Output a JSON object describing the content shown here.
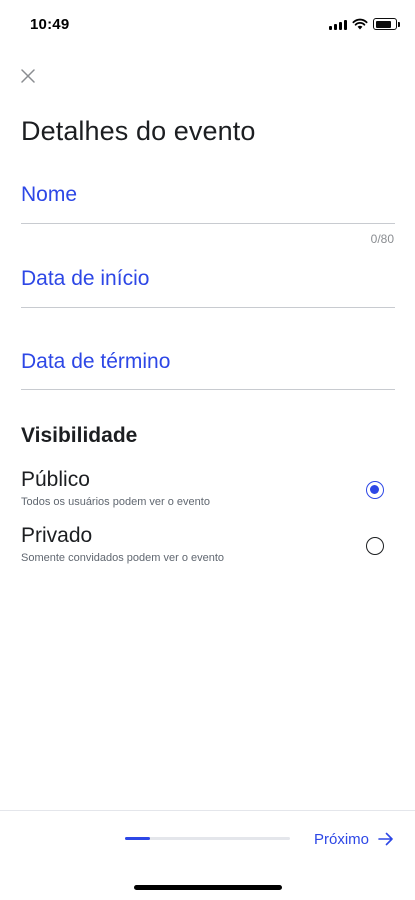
{
  "status_bar": {
    "time": "10:49",
    "icons": [
      "signal-icon",
      "wifi-icon",
      "battery-icon"
    ]
  },
  "header": {
    "close_icon": "close-icon",
    "title": "Detalhes do evento"
  },
  "form": {
    "name_label": "Nome",
    "name_counter": "0/80",
    "start_date_label": "Data de início",
    "end_date_label": "Data de término"
  },
  "visibility": {
    "title": "Visibilidade",
    "options": [
      {
        "title": "Público",
        "description": "Todos os usuários podem ver o evento",
        "selected": true
      },
      {
        "title": "Privado",
        "description": "Somente convidados podem ver o evento",
        "selected": false
      }
    ]
  },
  "footer": {
    "progress": 0.15,
    "next_label": "Próximo",
    "next_icon": "arrow-right-icon"
  },
  "colors": {
    "accent": "#2d47e6",
    "text": "#1c1e21",
    "divider": "#c8cbd0"
  }
}
